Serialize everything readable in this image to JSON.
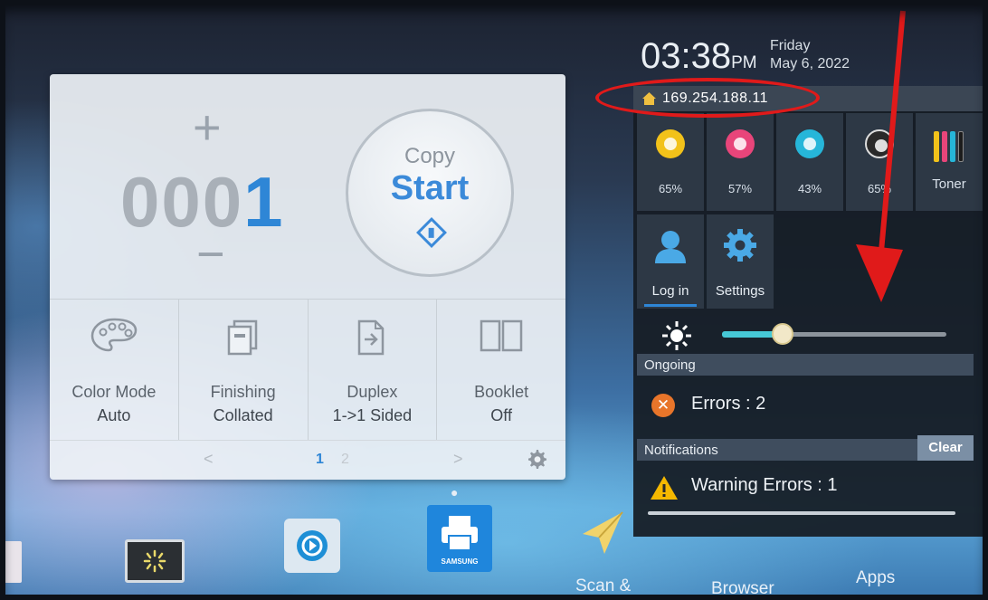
{
  "copy_panel": {
    "plus_symbol": "+",
    "minus_symbol": "−",
    "count_dim": "000",
    "count_highlight": "1",
    "start_button": {
      "line1": "Copy",
      "line2": "Start"
    },
    "functions": [
      {
        "icon": "palette-icon",
        "label": "Color Mode",
        "value": "Auto"
      },
      {
        "icon": "finishing-icon",
        "label": "Finishing",
        "value": "Collated"
      },
      {
        "icon": "duplex-icon",
        "label": "Duplex",
        "value": "1->1 Sided"
      },
      {
        "icon": "booklet-icon",
        "label": "Booklet",
        "value": "Off"
      }
    ],
    "pager": {
      "prev": "<",
      "page1": "1",
      "page2": "2",
      "next": ">"
    }
  },
  "status": {
    "time": "03:38",
    "ampm": "PM",
    "day": "Friday",
    "date": "May 6, 2022",
    "ip_address": "169.254.188.11"
  },
  "toners": [
    {
      "name": "Y",
      "percent": "65%",
      "color": "#f2c21a"
    },
    {
      "name": "M",
      "percent": "57%",
      "color": "#e8457a"
    },
    {
      "name": "C",
      "percent": "43%",
      "color": "#26b6d9"
    },
    {
      "name": "K",
      "percent": "65%",
      "color": "#2a2a2a"
    }
  ],
  "toner_tile_label": "Toner",
  "quick_actions": {
    "login": "Log in",
    "settings": "Settings"
  },
  "brightness_level": 0.27,
  "ongoing": {
    "header": "Ongoing",
    "message": "Errors : 2"
  },
  "notifications": {
    "header": "Notifications",
    "clear_label": "Clear",
    "message": "Warning Errors : 1"
  },
  "dock": {
    "items": [
      "Scan &",
      "Browser",
      "Apps"
    ],
    "brand": "SAMSUNG"
  },
  "colors": {
    "accent": "#2e86d6",
    "annotation": "#e01a1a",
    "error": "#e8752a",
    "warning": "#f5b800"
  }
}
